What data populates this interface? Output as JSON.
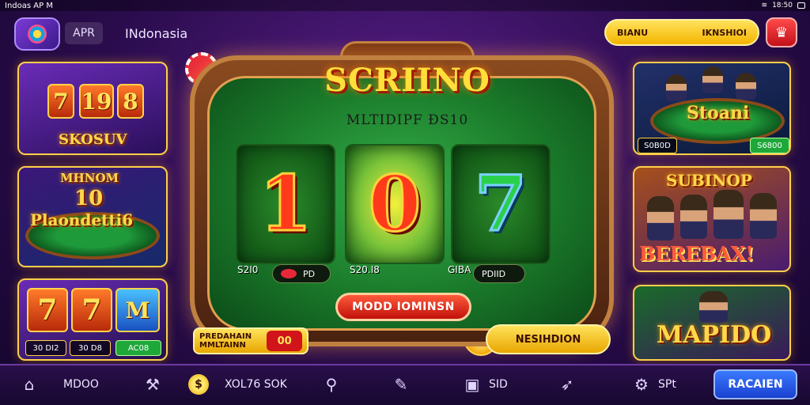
{
  "status_bar": {
    "left_text": "Indoas AP M",
    "right_text": "18:50"
  },
  "header": {
    "app_name": "APR",
    "region": "INdonasia",
    "promo_left": "BIANU",
    "promo_right": "IKNSHIOI"
  },
  "left_cards": [
    {
      "title": "SKOSUV",
      "reels": [
        "7",
        "19",
        "8"
      ]
    },
    {
      "title": "Plaondetti6",
      "top_label": "MHNOM",
      "number": "10"
    },
    {
      "reels": [
        "7",
        "7",
        "M"
      ],
      "values": [
        "30 DI2",
        "30 D8",
        "AC08"
      ]
    }
  ],
  "right_cards": [
    {
      "title": "Stoani",
      "values": [
        "S0B0D",
        "S6800"
      ]
    },
    {
      "title": "SUBINOP",
      "banner": "BEREBAX!"
    },
    {
      "title": "MAPIDO"
    }
  ],
  "machine": {
    "title": "SCRIINO",
    "subtitle": "MLTIDIPF ĐS10",
    "reels": [
      "1",
      "0",
      "7"
    ],
    "reel_values": [
      "S2I0",
      "S20.I8",
      "GIBA"
    ],
    "reel_badges": [
      "PD",
      "PDIID"
    ],
    "spin_label": "MODD IOMINSN",
    "left_info": {
      "line1": "PREDAHAIN",
      "line2": "MMLTAINN",
      "chip": "00"
    },
    "right_info": "NESIHDION"
  },
  "bottom_nav": {
    "home_label": "MDOO",
    "coin_label": "XOL76 SOK",
    "screen_label": "SID",
    "spt_label": "SPt",
    "primary_label": "RACAIEN"
  },
  "colors": {
    "background": "#2a0c4d",
    "accent_gold": "#ffd34a",
    "felt_green": "#1a7a2a",
    "primary_blue": "#1a40d0",
    "danger_red": "#c0100a"
  }
}
